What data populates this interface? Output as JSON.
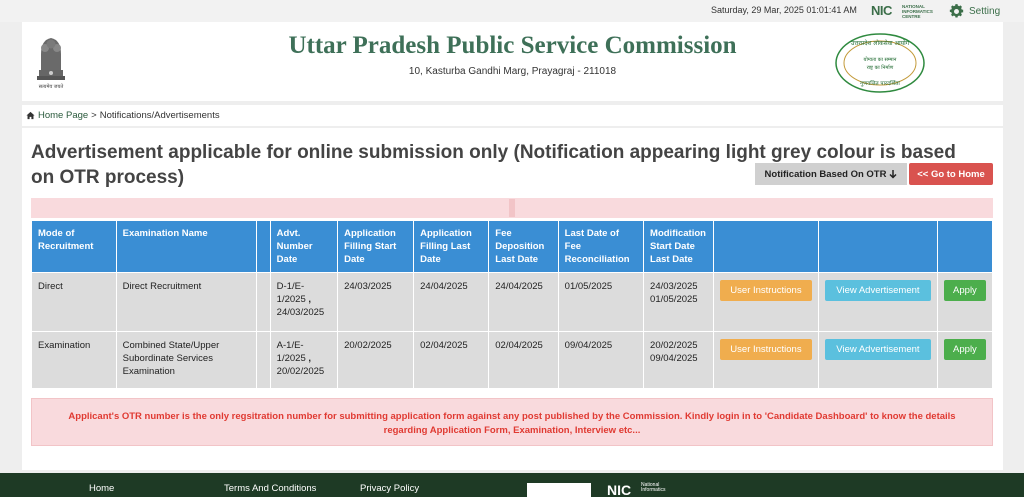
{
  "topbar": {
    "datetime": "Saturday, 29 Mar, 2025 01:01:41 AM",
    "nic_logo": "NIC",
    "nic_small": "NATIONAL INFORMATICS CENTRE",
    "setting_label": "Setting",
    "setting_icon": "gear-icon"
  },
  "header": {
    "title": "Uttar Pradesh Public Service Commission",
    "address": "10, Kasturba Gandhi Marg, Prayagraj - 211018",
    "emblem_text": "सत्यमेव जयते",
    "seal_top": "उत्तरप्रदेश लोकसेवा आयोग",
    "seal_mid1": "योग्यता का सम्मान",
    "seal_mid2": "राष्ट्र का निर्माण",
    "seal_bottom": "गुणवत्तित पारदर्शिता"
  },
  "breadcrumb": {
    "home_label": "Home Page",
    "separator": ">",
    "current": "Notifications/Advertisements"
  },
  "main": {
    "heading": "Advertisement applicable for online submission only (Notification appearing light grey colour is based on OTR process)",
    "otr_button": "Notification Based On OTR",
    "home_button": "<< Go to Home",
    "table": {
      "headers": [
        "Mode of Recruitment",
        "Examination Name",
        "",
        "Advt. Number Date",
        "Application Filling Start Date",
        "Application Filling Last Date",
        "Fee Deposition Last Date",
        "Last Date of Fee Reconciliation",
        "Modification Start Date Last Date",
        "",
        "",
        ""
      ],
      "rows": [
        {
          "mode": "Direct",
          "exam": "Direct Recruitment",
          "advt_number": "D-1/E-1/2025",
          "advt_date": "24/03/2025",
          "start": "24/03/2025",
          "last": "24/04/2025",
          "fee_last": "24/04/2025",
          "reconciliation": "01/05/2025",
          "mod_start": "24/03/2025",
          "mod_last": "01/05/2025"
        },
        {
          "mode": "Examination",
          "exam": "Combined State/Upper Subordinate Services Examination",
          "advt_number": "A-1/E-1/2025",
          "advt_date": "20/02/2025",
          "start": "20/02/2025",
          "last": "02/04/2025",
          "fee_last": "02/04/2025",
          "reconciliation": "09/04/2025",
          "mod_start": "20/02/2025",
          "mod_last": "09/04/2025"
        }
      ],
      "btn_instructions": "User Instructions",
      "btn_advertisement": "View Advertisement",
      "btn_apply": "Apply",
      "comma": ","
    },
    "notice": "Applicant's OTR number is the only regsitration number for submitting application form against any post published by the Commission. Kindly login in to 'Candidate Dashboard' to know the details regarding Application Form, Examination, Interview etc..."
  },
  "footer": {
    "links": [
      "Home",
      "Terms And Conditions",
      "Privacy Policy"
    ],
    "nic": "NIC",
    "nic_small": "National Informatics"
  },
  "colors": {
    "accent_green": "#3e7058",
    "table_header": "#3a8ed4",
    "btn_red": "#d9534f",
    "btn_orange": "#f0ad4e",
    "btn_cyan": "#5bc0de",
    "btn_green": "#4cae4c",
    "footer_bg": "#1e3a25"
  }
}
